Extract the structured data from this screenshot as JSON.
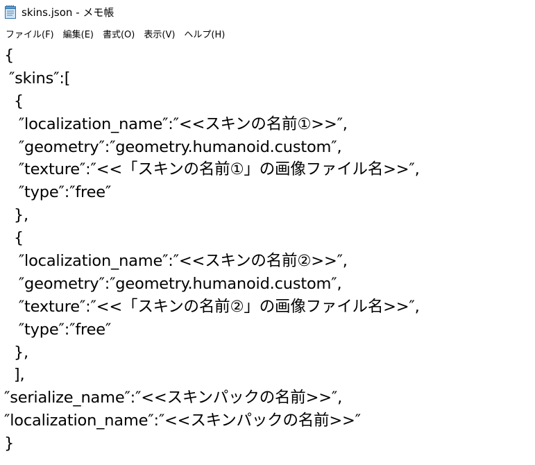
{
  "window": {
    "title": "skins.json - メモ帳"
  },
  "icons": {
    "app": "notepad-icon"
  },
  "menu": {
    "items": [
      {
        "label": "ファイル(F)"
      },
      {
        "label": "編集(E)"
      },
      {
        "label": "書式(O)"
      },
      {
        "label": "表示(V)"
      },
      {
        "label": "ヘルプ(H)"
      }
    ]
  },
  "editor": {
    "lines": [
      "{",
      " ″skins″:[",
      "  {",
      "   ″localization_name″:″<<スキンの名前①>>″,",
      "   ″geometry″:″geometry.humanoid.custom″,",
      "   ″texture″:″<<「スキンの名前①」の画像ファイル名>>″,",
      "   ″type″:″free″",
      "  },",
      "  {",
      "   ″localization_name″:″<<スキンの名前②>>″,",
      "   ″geometry″:″geometry.humanoid.custom″,",
      "   ″texture″:″<<「スキンの名前②」の画像ファイル名>>″,",
      "   ″type″:″free″",
      "  },",
      "  ],",
      "″serialize_name″:″<<スキンパックの名前>>″,",
      "″localization_name″:″<<スキンパックの名前>>″",
      "}"
    ]
  }
}
